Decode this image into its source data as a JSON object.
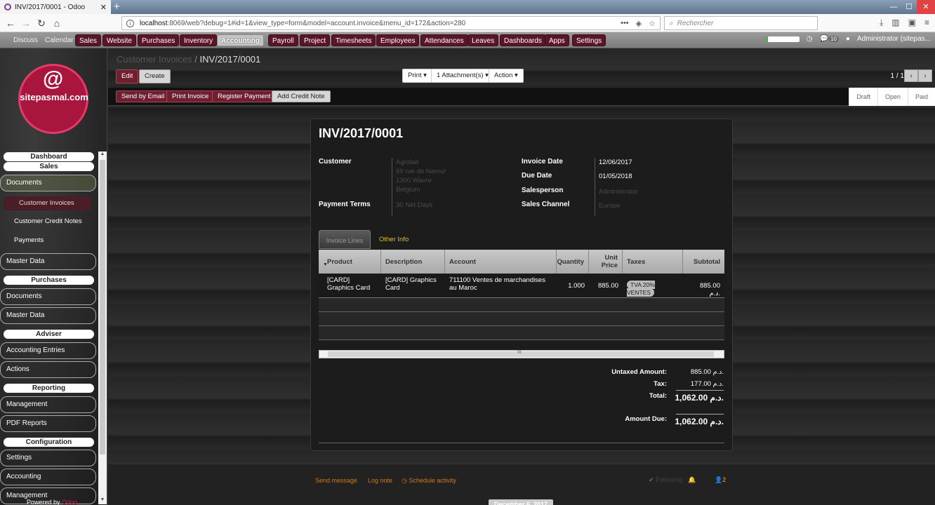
{
  "browser": {
    "tab_title": "INV/2017/0001 - Odoo",
    "url_host": "localhost",
    "url_rest": ":8069/web?debug=1#id=1&view_type=form&model=account.invoice&menu_id=172&action=280",
    "search_placeholder": "Rechercher"
  },
  "topmenu": {
    "discuss": "Discuss",
    "calendar": "Calendar",
    "sales": "Sales",
    "website": "Website",
    "purchases": "Purchases",
    "inventory": "Inventory",
    "accounting": "Accounting",
    "payroll": "Payroll",
    "project": "Project",
    "timesheets": "Timesheets",
    "employees": "Employees",
    "attendances": "Attendances",
    "leaves": "Leaves",
    "dashboards": "Dashboards",
    "apps": "Apps",
    "settings": "Settings",
    "messages_count": "10",
    "user": "Administrator (sitepas..."
  },
  "sidebar": {
    "logo_text": "sitepasmal.com",
    "dashboard": "Dashboard",
    "sales_header": "Sales",
    "documents": "Documents",
    "customer_invoices": "Customer Invoices",
    "customer_credit_notes": "Customer Credit Notes",
    "payments": "Payments",
    "master_data": "Master Data",
    "purchases_header": "Purchases",
    "p_documents": "Documents",
    "p_master_data": "Master Data",
    "adviser_header": "Adviser",
    "accounting_entries": "Accounting Entries",
    "actions": "Actions",
    "reporting_header": "Reporting",
    "management": "Management",
    "pdf_reports": "PDF Reports",
    "configuration_header": "Configuration",
    "settings": "Settings",
    "accounting": "Accounting",
    "management2": "Management",
    "powered_by": "Powered by",
    "powered_brand": "Odoo"
  },
  "control": {
    "breadcrumb_parent": "Customer Invoices",
    "breadcrumb_sep": "/",
    "breadcrumb_current": "INV/2017/0001",
    "edit": "Edit",
    "create": "Create",
    "print": "Print ▾",
    "attachments": "1 Attachment(s) ▾",
    "action": "Action ▾",
    "pager": "1 / 1",
    "send_email": "Send by Email",
    "print_invoice": "Print Invoice",
    "register_payment": "Register Payment",
    "add_credit_note": "Add Credit Note",
    "states": [
      "Draft",
      "Open",
      "Paid"
    ]
  },
  "invoice": {
    "number": "INV/2017/0001",
    "customer_label": "Customer",
    "customer_name": "Agrolait",
    "customer_addr1": "69 rue de Namur",
    "customer_addr2": "1300 Wavre",
    "customer_addr3": "Belgium",
    "payment_terms_label": "Payment Terms",
    "payment_terms": "30 Net Days",
    "invoice_date_label": "Invoice Date",
    "invoice_date": "12/06/2017",
    "due_date_label": "Due Date",
    "due_date": "01/05/2018",
    "salesperson_label": "Salesperson",
    "salesperson": "Administrator",
    "sales_channel_label": "Sales Channel",
    "sales_channel": "Europe",
    "tab_lines": "Invoice Lines",
    "tab_other": "Other Info",
    "columns": {
      "product": "Product",
      "description": "Description",
      "account": "Account",
      "quantity": "Quantity",
      "unit_price": "Unit Price",
      "taxes": "Taxes",
      "subtotal": "Subtotal"
    },
    "line": {
      "product": "[CARD] Graphics Card",
      "description": "[CARD] Graphics Card",
      "account": "711100 Ventes de marchandises au Maroc",
      "quantity": "1.000",
      "unit_price": "885.00",
      "taxes": "TVA 20% VENTES",
      "subtotal": "885.00 د.م."
    },
    "untaxed_label": "Untaxed Amount:",
    "untaxed": "885.00 د.م.",
    "tax_label": "Tax:",
    "tax": "177.00 د.م.",
    "total_label": "Total:",
    "total": "1,062.00 د.م.",
    "amount_due_label": "Amount Due:",
    "amount_due": "1,062.00 د.م."
  },
  "chatter": {
    "send_message": "Send message",
    "log_note": "Log note",
    "schedule_activity": "Schedule activity",
    "following": "Following",
    "followers_count": "2",
    "date_badge": "December 6, 2017"
  }
}
